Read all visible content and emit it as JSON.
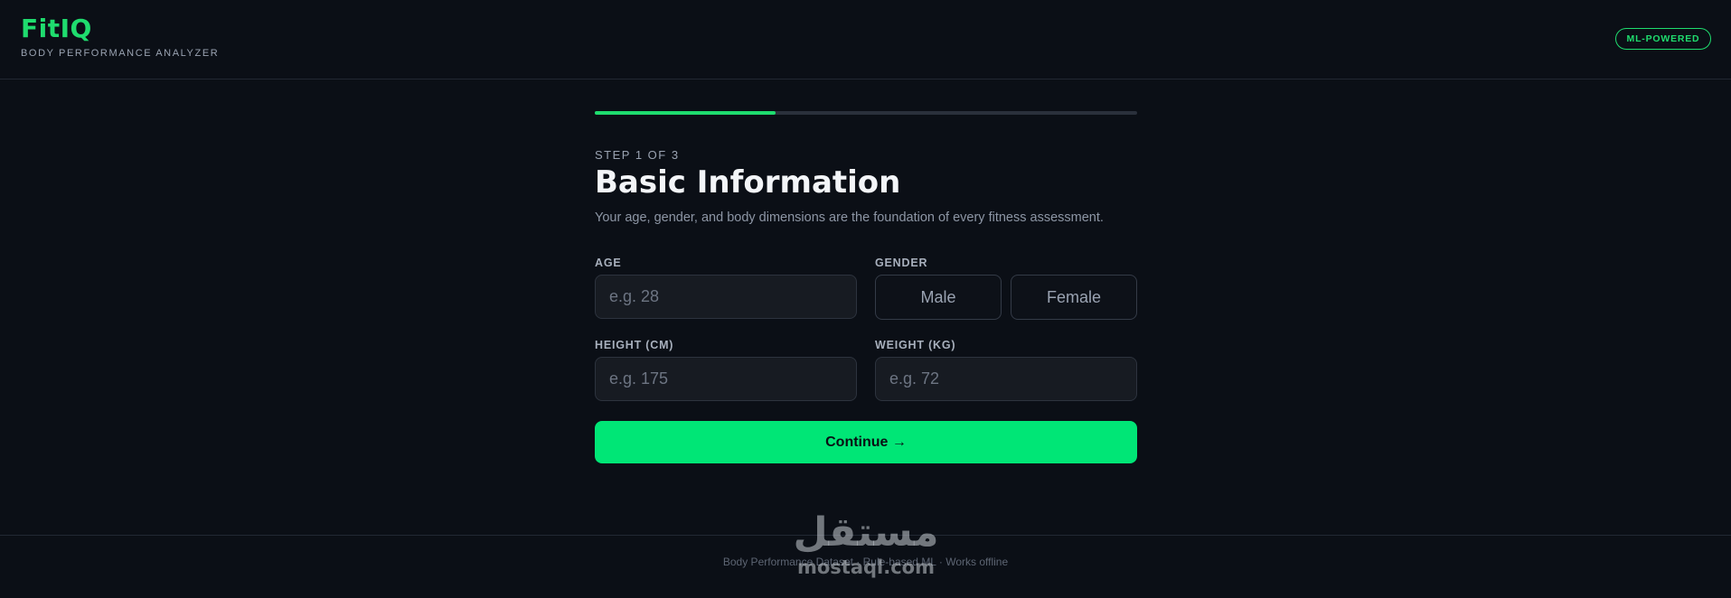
{
  "header": {
    "logo": "FitIQ",
    "tagline": "BODY PERFORMANCE ANALYZER",
    "badge": "ML-POWERED"
  },
  "progress": {
    "current_step": 1,
    "total_steps": 3,
    "fraction": 0.333
  },
  "form": {
    "step_label": "STEP 1 OF 3",
    "title": "Basic Information",
    "description": "Your age, gender, and body dimensions are the foundation of every fitness assessment.",
    "age": {
      "label": "AGE",
      "placeholder": "e.g. 28",
      "value": ""
    },
    "gender": {
      "label": "GENDER",
      "options": [
        "Male",
        "Female"
      ],
      "selected": ""
    },
    "height": {
      "label": "HEIGHT (CM)",
      "placeholder": "e.g. 175",
      "value": ""
    },
    "weight": {
      "label": "WEIGHT (KG)",
      "placeholder": "e.g. 72",
      "value": ""
    },
    "continue_label": "Continue →"
  },
  "footer": {
    "text": "Body Performance Dataset · Rule-based ML · Works offline"
  },
  "watermark": {
    "arabic": "مستقل",
    "latin": "mostaql.com"
  },
  "colors": {
    "accent": "#1fdc6e",
    "button": "#00e676",
    "background": "#0b0f16"
  }
}
